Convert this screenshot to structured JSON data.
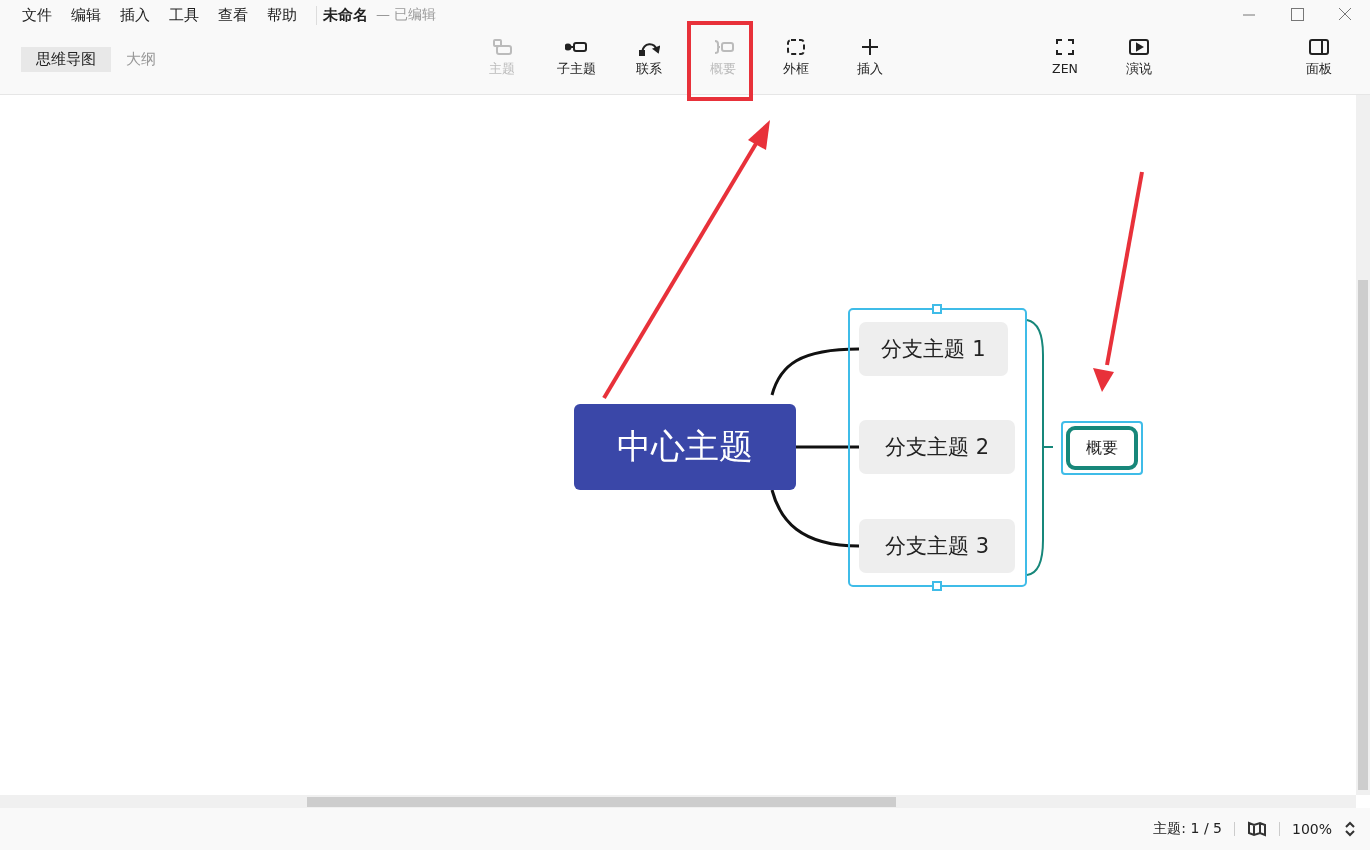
{
  "menu": [
    "文件",
    "编辑",
    "插入",
    "工具",
    "查看",
    "帮助"
  ],
  "document": {
    "title": "未命名",
    "status": "— 已编辑"
  },
  "view_tabs": [
    {
      "label": "思维导图",
      "selected": true
    },
    {
      "label": "大纲",
      "selected": false
    }
  ],
  "toolbar": [
    {
      "label": "主题",
      "kind": "topic",
      "disabled": true,
      "highlighted": false
    },
    {
      "label": "子主题",
      "kind": "subtopic",
      "disabled": false,
      "highlighted": false
    },
    {
      "label": "联系",
      "kind": "relation",
      "disabled": false,
      "highlighted": false
    },
    {
      "label": "概要",
      "kind": "summary",
      "disabled": true,
      "highlighted": true
    },
    {
      "label": "外框",
      "kind": "boundary",
      "disabled": false,
      "highlighted": false
    },
    {
      "label": "插入",
      "kind": "insert",
      "disabled": false,
      "highlighted": false
    },
    {
      "label": "ZEN",
      "kind": "zen",
      "disabled": false,
      "highlighted": false
    },
    {
      "label": "演说",
      "kind": "present",
      "disabled": false,
      "highlighted": false
    },
    {
      "label": "面板",
      "kind": "panel",
      "disabled": false,
      "highlighted": false
    }
  ],
  "map": {
    "central": "中心主题",
    "branches": [
      {
        "label": "分支主题 1"
      },
      {
        "label": "分支主题 2"
      },
      {
        "label": "分支主题 3"
      }
    ],
    "summary": {
      "label": "概要",
      "selected": true
    }
  },
  "status_bar": {
    "topic_count": "主题: 1 / 5",
    "zoom": "100%"
  }
}
